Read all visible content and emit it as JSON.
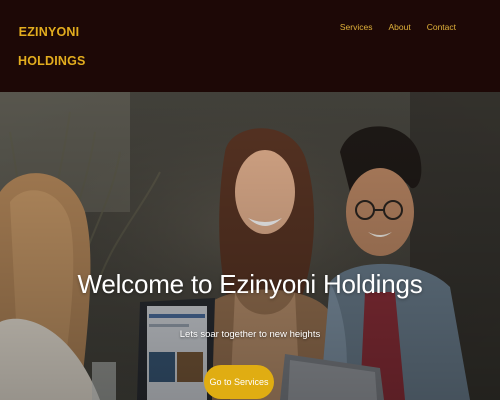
{
  "brand": {
    "line1": "EZINYONI",
    "line2": "HOLDINGS"
  },
  "nav": {
    "items": [
      "Services",
      "About",
      "Contact"
    ]
  },
  "hero": {
    "title": "Welcome to Ezinyoni Holdings",
    "subtitle": "Lets soar together to new heights",
    "cta_label": "Go to Services"
  },
  "colors": {
    "header_bg": "#1d0806",
    "brand_gold": "#e3ad1e",
    "cta_bg": "#e0ad12"
  }
}
